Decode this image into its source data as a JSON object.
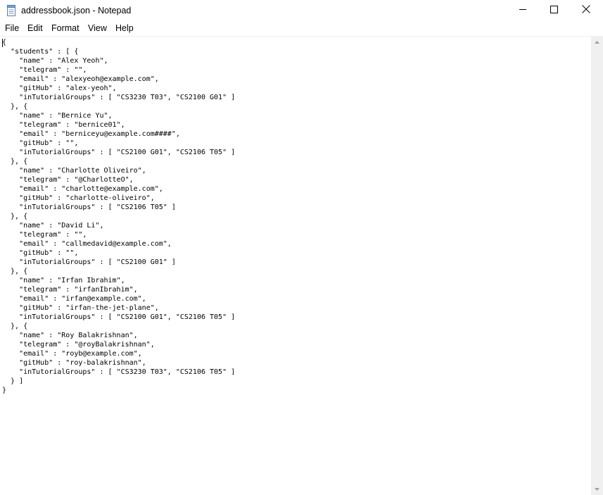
{
  "window": {
    "title": "addressbook.json - Notepad",
    "app_icon": "notepad-icon",
    "controls": {
      "minimize_icon": "minimize-icon",
      "maximize_icon": "maximize-icon",
      "close_icon": "close-icon"
    }
  },
  "menu": {
    "file": "File",
    "edit": "Edit",
    "format": "Format",
    "view": "View",
    "help": "Help"
  },
  "editor": {
    "content": "{\n  \"students\" : [ {\n    \"name\" : \"Alex Yeoh\",\n    \"telegram\" : \"\",\n    \"email\" : \"alexyeoh@example.com\",\n    \"gitHub\" : \"alex-yeoh\",\n    \"inTutorialGroups\" : [ \"CS3230 T03\", \"CS2100 G01\" ]\n  }, {\n    \"name\" : \"Bernice Yu\",\n    \"telegram\" : \"bernice01\",\n    \"email\" : \"berniceyu@example.com####\",\n    \"gitHub\" : \"\",\n    \"inTutorialGroups\" : [ \"CS2100 G01\", \"CS2106 T05\" ]\n  }, {\n    \"name\" : \"Charlotte Oliveiro\",\n    \"telegram\" : \"@CharlotteO\",\n    \"email\" : \"charlotte@example.com\",\n    \"gitHub\" : \"charlotte-oliveiro\",\n    \"inTutorialGroups\" : [ \"CS2106 T05\" ]\n  }, {\n    \"name\" : \"David Li\",\n    \"telegram\" : \"\",\n    \"email\" : \"callmedavid@example.com\",\n    \"gitHub\" : \"\",\n    \"inTutorialGroups\" : [ \"CS2100 G01\" ]\n  }, {\n    \"name\" : \"Irfan Ibrahim\",\n    \"telegram\" : \"irfanIbrahim\",\n    \"email\" : \"irfan@example.com\",\n    \"gitHub\" : \"irfan-the-jet-plane\",\n    \"inTutorialGroups\" : [ \"CS2100 G01\", \"CS2106 T05\" ]\n  }, {\n    \"name\" : \"Roy Balakrishnan\",\n    \"telegram\" : \"@royBalakrishnan\",\n    \"email\" : \"royb@example.com\",\n    \"gitHub\" : \"roy-balakrishnan\",\n    \"inTutorialGroups\" : [ \"CS3230 T03\", \"CS2106 T05\" ]\n  } ]\n}"
  },
  "colors": {
    "window_bg": "#ffffff",
    "scrollbar_track": "#f0f0f0",
    "text": "#000000"
  }
}
